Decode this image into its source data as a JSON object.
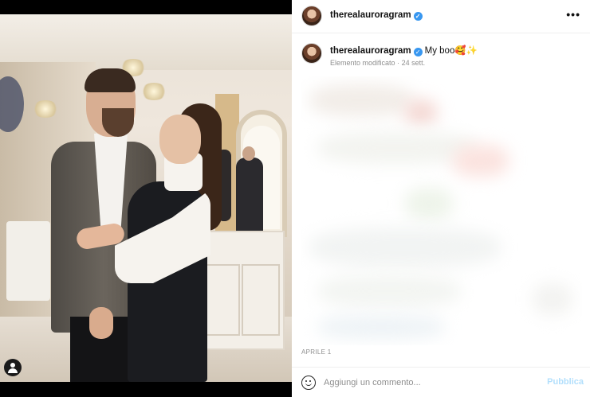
{
  "post": {
    "username": "therealauroragram",
    "verified_icon": "verified-badge-icon",
    "more_glyph": "•••",
    "caption_text": "My boo🥰✨",
    "edited_label": "Elemento modificato",
    "time_ago": "24 sett.",
    "date_label": "APRILE 1",
    "accent_color": "#3897f0"
  },
  "composer": {
    "placeholder": "Aggiungi un commento...",
    "post_label": "Pubblica",
    "post_color": "#b2dffc"
  },
  "photo": {
    "tagged_user_icon": "user-tag-icon"
  }
}
